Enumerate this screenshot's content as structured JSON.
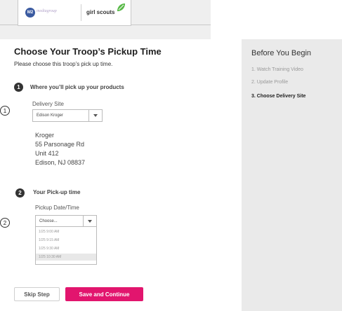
{
  "header": {
    "brand_logo_text": "M2",
    "brand_subtext": "mediagroup",
    "partner_name": "girl scouts"
  },
  "main": {
    "title": "Choose Your Troop’s Pickup Time",
    "subtitle": "Please choose this troop’s pick up time.",
    "step1": {
      "number": "1",
      "title": "Where you’ll pick up your products",
      "callout": "1",
      "field_label": "Delivery Site",
      "selected_site": "Edison Kroger",
      "address": [
        "Kroger",
        "55 Parsonage Rd",
        "Unit 412",
        "Edison, NJ 08837"
      ]
    },
    "step2": {
      "number": "2",
      "title": "Your Pick-up time",
      "callout": "2",
      "field_label": "Pickup Date/Time",
      "selected_value": "Choose...",
      "options": [
        "1/25 9:00 AM",
        "1/25 9:15 AM",
        "1/25 9:30 AM",
        "1/25 10:30 AM"
      ]
    },
    "buttons": {
      "skip": "Skip Step",
      "save": "Save and Continue"
    }
  },
  "sidebar": {
    "title": "Before You Begin",
    "steps": [
      "1. Watch Training Video",
      "2. Update Profile",
      "3. Choose Delivery Site"
    ],
    "active_step_index": 2
  },
  "colors": {
    "accent": "#e2156e",
    "sidebar_bg": "#eaeaea",
    "header_bg": "#efefef",
    "brand_blue": "#3a5aa0",
    "gs_green": "#58b947"
  },
  "icons": {
    "dropdown": "chevron-down-icon",
    "brand_leaf": "leaf-icon"
  }
}
